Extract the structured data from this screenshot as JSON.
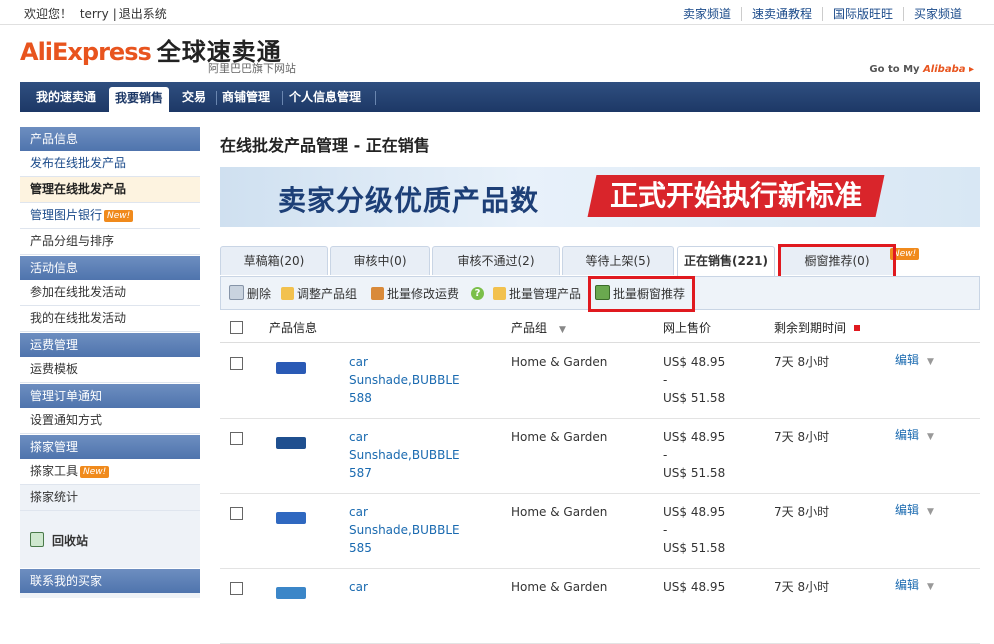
{
  "topbar": {
    "welcome": "欢迎您！",
    "username": "terry",
    "logout": "退出系统",
    "links": [
      "卖家频道",
      "速卖通教程",
      "国际版旺旺",
      "买家频道"
    ]
  },
  "logo": {
    "brand": "AliExpress",
    "brand_cn": "全球速卖通",
    "subtitle": "阿里巴巴旗下网站",
    "goto": "Go to My",
    "goto_brand": "Alibaba",
    "goto_arrow": "▸"
  },
  "nav": {
    "tabs": [
      "我的速卖通",
      "我要销售",
      "交易",
      "商铺管理",
      "个人信息管理"
    ],
    "active_index": 1
  },
  "sidebar": {
    "sections": [
      {
        "title": "产品信息",
        "items": [
          {
            "label": "发布在线批发产品",
            "badge": ""
          },
          {
            "label": "管理在线批发产品",
            "badge": ""
          },
          {
            "label": "管理图片银行",
            "badge": "New!"
          },
          {
            "label": "产品分组与排序",
            "badge": ""
          }
        ]
      },
      {
        "title": "活动信息",
        "items": [
          {
            "label": "参加在线批发活动",
            "badge": ""
          },
          {
            "label": "我的在线批发活动",
            "badge": ""
          }
        ]
      },
      {
        "title": "运费管理",
        "items": [
          {
            "label": "运费模板",
            "badge": ""
          }
        ]
      },
      {
        "title": "管理订单通知",
        "items": [
          {
            "label": "设置通知方式",
            "badge": ""
          }
        ]
      },
      {
        "title": "搽家管理",
        "items": [
          {
            "label": "搽家工具",
            "badge": "New!"
          },
          {
            "label": "搽家统计",
            "badge": ""
          }
        ]
      }
    ],
    "recycle": "回收站",
    "bottom_section": "联系我的买家"
  },
  "main": {
    "title": "在线批发产品管理 - 正在销售",
    "banner_left": "卖家分级优质产品数",
    "banner_right": "正式开始执行新标准",
    "tabs": [
      {
        "label": "草稿箱(20)"
      },
      {
        "label": "审核中(0)"
      },
      {
        "label": "审核不通过(2)"
      },
      {
        "label": "等待上架(5)"
      },
      {
        "label": "正在销售(221)"
      },
      {
        "label": "橱窗推荐(0)"
      }
    ],
    "active_tab_index": 4,
    "new_tag": "New!",
    "toolbar": {
      "delete": "删除",
      "adjust_group": "调整产品组",
      "batch_shipping": "批量修改运费",
      "help": "?",
      "batch_manage": "批量管理产品",
      "batch_showcase": "批量橱窗推荐"
    },
    "table": {
      "headers": {
        "product_info": "产品信息",
        "product_group": "产品组",
        "price": "网上售价",
        "expiry": "剩余到期时间"
      },
      "rows": [
        {
          "name": "car Sunshade,BUBBLE 588",
          "group": "Home & Garden",
          "price_low": "US$ 48.95",
          "dash": "-",
          "price_high": "US$ 51.58",
          "expiry": "7天 8小时",
          "edit": "编辑",
          "thumb_color": "#2a5ab5"
        },
        {
          "name": "car Sunshade,BUBBLE 587",
          "group": "Home & Garden",
          "price_low": "US$ 48.95",
          "dash": "-",
          "price_high": "US$ 51.58",
          "expiry": "7天 8小时",
          "edit": "编辑",
          "thumb_color": "#1f4f8f"
        },
        {
          "name": "car Sunshade,BUBBLE 585",
          "group": "Home & Garden",
          "price_low": "US$ 48.95",
          "dash": "-",
          "price_high": "US$ 51.58",
          "expiry": "7天 8小时",
          "edit": "编辑",
          "thumb_color": "#2f68c0"
        },
        {
          "name": "car",
          "group": "Home & Garden",
          "price_low": "US$ 48.95",
          "dash": "",
          "price_high": "",
          "expiry": "7天 8小时",
          "edit": "编辑",
          "thumb_color": "#3b86c8"
        }
      ]
    }
  },
  "colors": {
    "nav_bg": "#1d3866",
    "brand_orange": "#e8541e",
    "highlight_red": "#e0191f",
    "link_blue": "#1a6ab0"
  }
}
